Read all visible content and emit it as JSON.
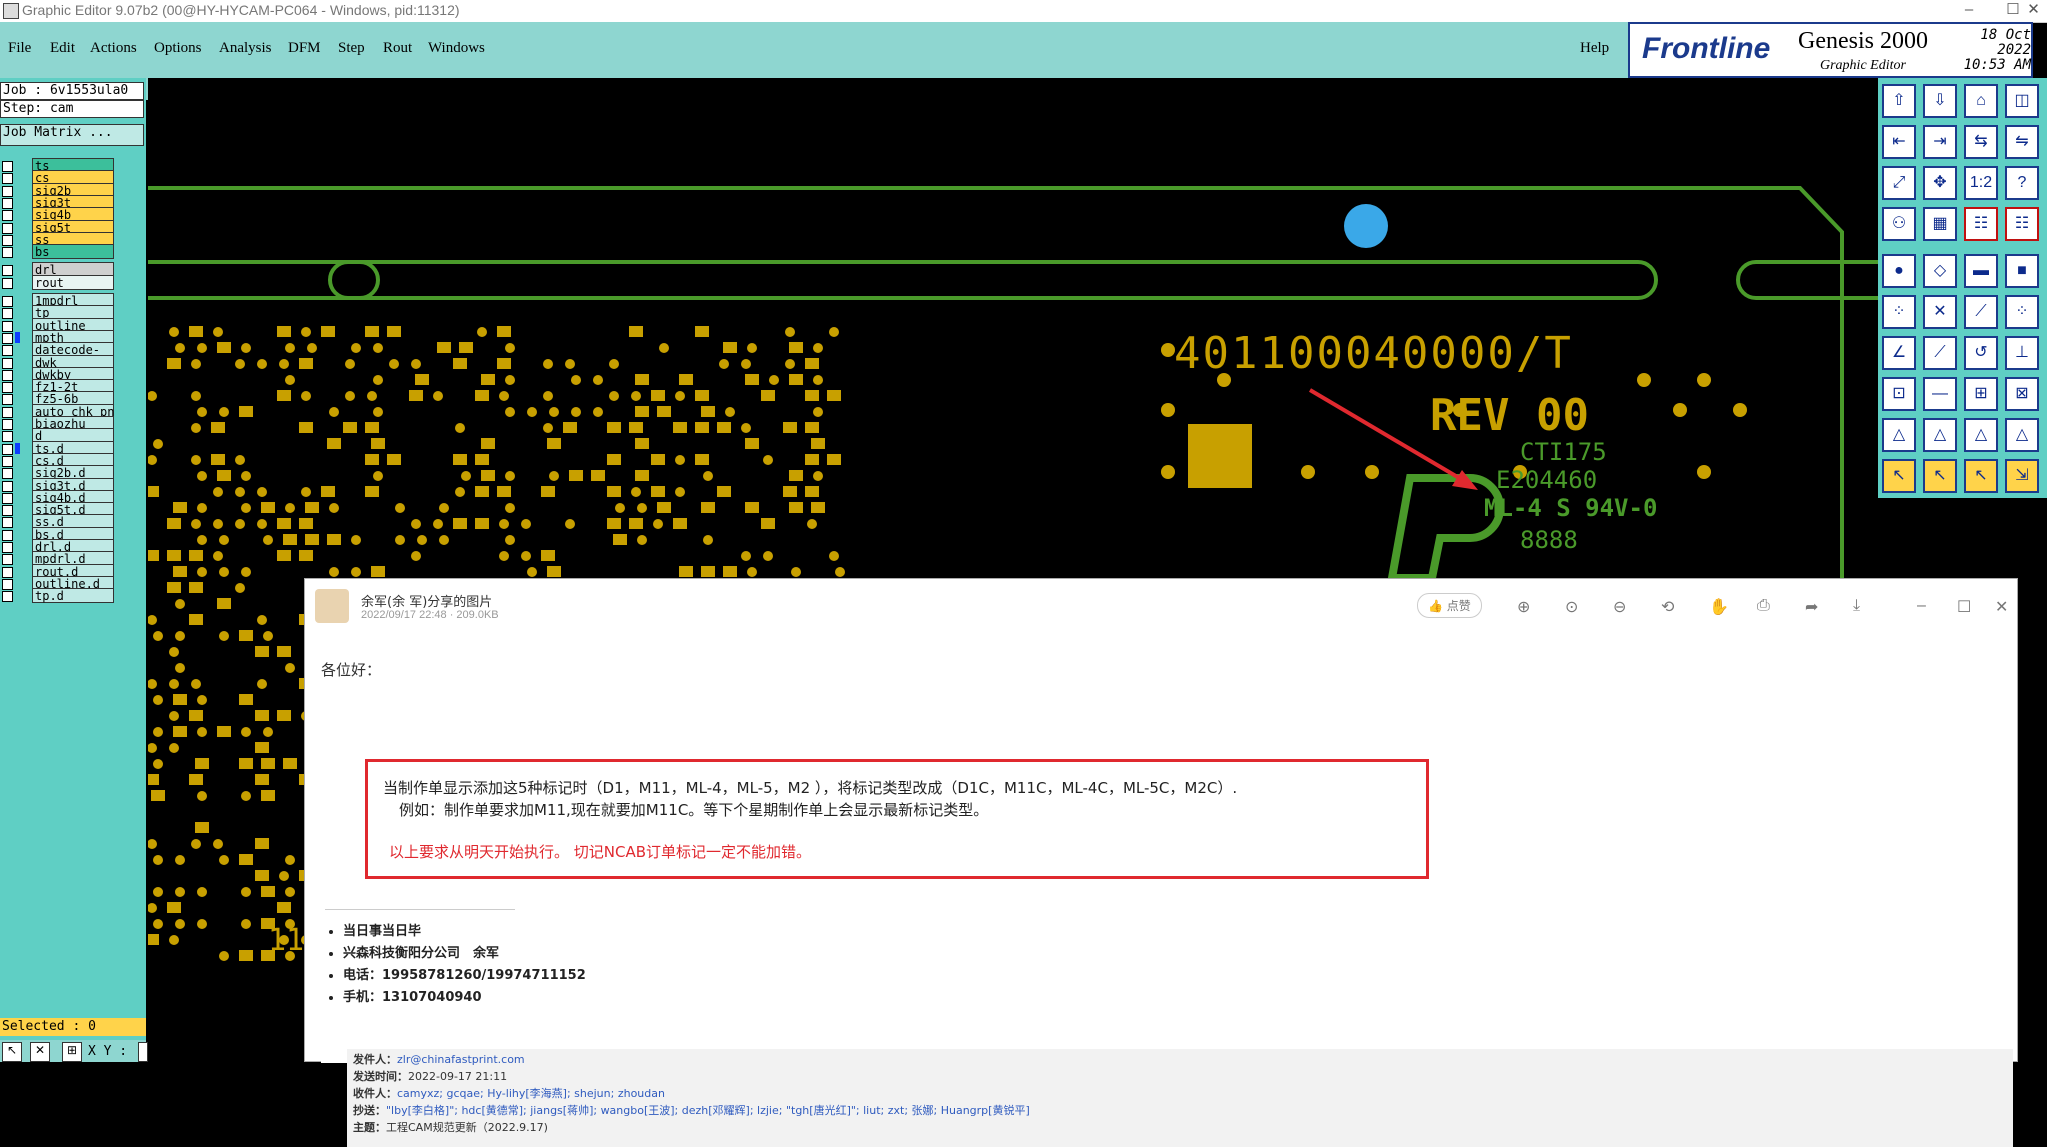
{
  "window": {
    "title": "Graphic Editor 9.07b2 (00@HY-HYCAM-PC064 - Windows, pid:11312)",
    "minimize": "–",
    "maximize": "☐",
    "close": "✕"
  },
  "menu": {
    "items": [
      "File",
      "Edit",
      "Actions",
      "Options",
      "Analysis",
      "DFM",
      "Step",
      "Rout",
      "Windows"
    ],
    "help": "Help"
  },
  "brand": {
    "logo": "Frontline",
    "product": "Genesis 2000",
    "subtitle": "Graphic Editor",
    "date": "18 Oct 2022",
    "time": "10:53 AM"
  },
  "job": {
    "job": "Job : 6v1553ula0",
    "step": "Step: cam",
    "matrix": "Job Matrix ..."
  },
  "layers": [
    {
      "name": "ts",
      "color": "#3cbf9b",
      "swatch": false
    },
    {
      "name": "cs",
      "color": "#ffd34a",
      "swatch": false
    },
    {
      "name": "sig2b",
      "color": "#ffd34a",
      "swatch": false
    },
    {
      "name": "sig3t",
      "color": "#ffd34a",
      "swatch": false
    },
    {
      "name": "sig4b",
      "color": "#ffd34a",
      "swatch": false
    },
    {
      "name": "sig5t",
      "color": "#ffd34a",
      "swatch": false
    },
    {
      "name": "ss",
      "color": "#ffd34a",
      "swatch": false
    },
    {
      "name": "bs",
      "color": "#3cbf9b",
      "swatch": false
    },
    {
      "name": "drl",
      "color": "#cfcfcf",
      "swatch": false
    },
    {
      "name": "rout",
      "color": "#e8f4f2",
      "swatch": false
    },
    {
      "name": "1mpdrl",
      "color": "#bfe9e5",
      "swatch": false
    },
    {
      "name": "tp",
      "color": "#bfe9e5",
      "swatch": false
    },
    {
      "name": "outline",
      "color": "#bfe9e5",
      "swatch": false
    },
    {
      "name": "mpth",
      "color": "#bfe9e5",
      "swatch": true
    },
    {
      "name": "datecode-ts",
      "color": "#bfe9e5",
      "swatch": false
    },
    {
      "name": "dwk",
      "color": "#bfe9e5",
      "swatch": false
    },
    {
      "name": "dwkby",
      "color": "#bfe9e5",
      "swatch": false
    },
    {
      "name": "fz1-2t",
      "color": "#bfe9e5",
      "swatch": false
    },
    {
      "name": "fz5-6b",
      "color": "#bfe9e5",
      "swatch": false
    },
    {
      "name": "auto_chk_pn",
      "color": "#bfe9e5",
      "swatch": false
    },
    {
      "name": "biaozhu",
      "color": "#bfe9e5",
      "swatch": false
    },
    {
      "name": "d",
      "color": "#bfe9e5",
      "swatch": false
    },
    {
      "name": "ts.d",
      "color": "#bfe9e5",
      "swatch": true
    },
    {
      "name": "cs.d",
      "color": "#bfe9e5",
      "swatch": false
    },
    {
      "name": "sig2b.d",
      "color": "#bfe9e5",
      "swatch": false
    },
    {
      "name": "sig3t.d",
      "color": "#bfe9e5",
      "swatch": false
    },
    {
      "name": "sig4b.d",
      "color": "#bfe9e5",
      "swatch": false
    },
    {
      "name": "sig5t.d",
      "color": "#bfe9e5",
      "swatch": false
    },
    {
      "name": "ss.d",
      "color": "#bfe9e5",
      "swatch": false
    },
    {
      "name": "bs.d",
      "color": "#bfe9e5",
      "swatch": false
    },
    {
      "name": "drl.d",
      "color": "#bfe9e5",
      "swatch": false
    },
    {
      "name": "mpdrl.d",
      "color": "#bfe9e5",
      "swatch": false
    },
    {
      "name": "rout.d",
      "color": "#bfe9e5",
      "swatch": false
    },
    {
      "name": "outline.d",
      "color": "#bfe9e5",
      "swatch": false
    },
    {
      "name": "tp.d",
      "color": "#bfe9e5",
      "swatch": false
    }
  ],
  "status": {
    "selected": "Selected : 0",
    "coords": "X Y :"
  },
  "board": {
    "part": "401100040000/T",
    "rev": "REV 00",
    "cti": "CTI175",
    "ul": "E204460",
    "grade": "ML-4 S 94V-0",
    "code": "8888",
    "edge": "11"
  },
  "viewer": {
    "title": "余军(余 军)分享的图片",
    "meta": "2022/09/17 22:48 · 209.0KB",
    "like": "点赞",
    "greeting": "各位好：",
    "notice_line1": "当制作单显示添加这5种标记时（D1，M11，ML-4，ML-5，M2 ），将标记类型改成（D1C，M11C，ML-4C，ML-5C，M2C）.",
    "notice_line2": "例如：制作单要求加M11,现在就要加M11C。等下个星期制作单上会显示最新标记类型。",
    "notice_red": "以上要求从明天开始执行。 切记NCAB订单标记一定不能加错。",
    "bullets": [
      "当日事当日毕",
      "兴森科技衡阳分公司　余军",
      "电话：19958781260/19974711152",
      "手机：13107040940"
    ],
    "mail": [
      {
        "k": "发件人：",
        "v": "zlr@chinafastprint.com"
      },
      {
        "k": "发送时间：",
        "v": "2022-09-17 21:11"
      },
      {
        "k": "收件人：",
        "v": "camyxz; gcqae; Hy-lihy[李海燕]; shejun; zhoudan"
      },
      {
        "k": "抄送：",
        "v": "\"lby[李白格]\"; hdc[黄德常]; jiangs[蒋帅]; wangbo[王波]; dezh[邓耀辉]; lzjie; \"tgh[唐光红]\"; liut; zxt; 张娜; Huangrp[黄锐平]"
      },
      {
        "k": "主题：",
        "v": "工程CAM规范更新（2022.9.17)"
      }
    ]
  }
}
